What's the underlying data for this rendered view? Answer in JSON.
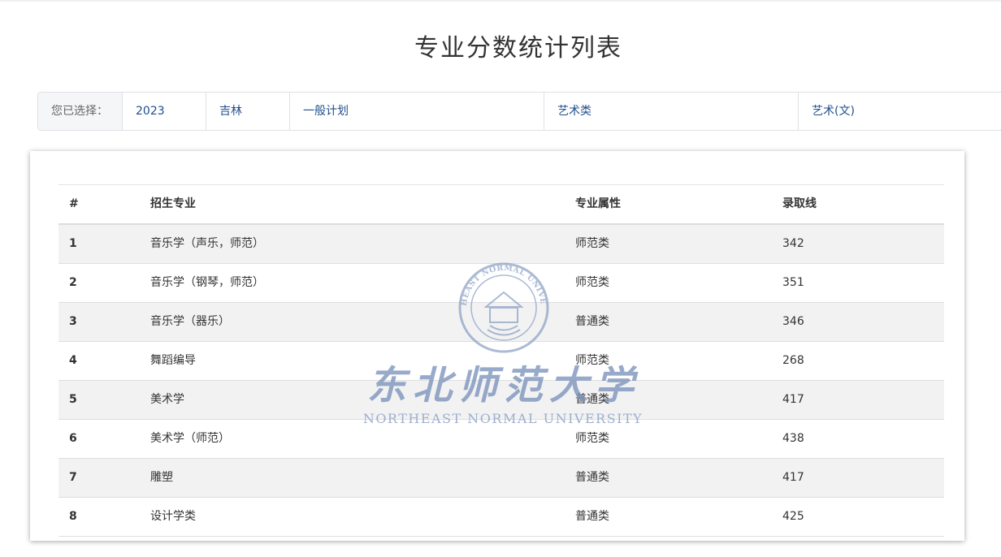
{
  "page": {
    "title": "专业分数统计列表"
  },
  "filters": {
    "label": "您已选择：",
    "year": "2023",
    "province": "吉林",
    "plan": "一般计划",
    "category": "艺术类",
    "subject": "艺术(文)"
  },
  "table": {
    "headers": {
      "index": "#",
      "major": "招生专业",
      "attribute": "专业属性",
      "score": "录取线"
    },
    "rows": [
      {
        "index": "1",
        "major": "音乐学（声乐，师范）",
        "attribute": "师范类",
        "score": "342"
      },
      {
        "index": "2",
        "major": "音乐学（钢琴，师范）",
        "attribute": "师范类",
        "score": "351"
      },
      {
        "index": "3",
        "major": "音乐学（器乐）",
        "attribute": "普通类",
        "score": "346"
      },
      {
        "index": "4",
        "major": "舞蹈编导",
        "attribute": "师范类",
        "score": "268"
      },
      {
        "index": "5",
        "major": "美术学",
        "attribute": "普通类",
        "score": "417"
      },
      {
        "index": "6",
        "major": "美术学（师范）",
        "attribute": "师范类",
        "score": "438"
      },
      {
        "index": "7",
        "major": "雕塑",
        "attribute": "普通类",
        "score": "417"
      },
      {
        "index": "8",
        "major": "设计学类",
        "attribute": "普通类",
        "score": "425"
      }
    ]
  },
  "watermark": {
    "seal_text": "NORTHEAST NORMAL UNIVERSITY",
    "name_cn": "东北师范大学",
    "name_en": "NORTHEAST NORMAL UNIVERSITY",
    "color": "#7f95bd"
  }
}
